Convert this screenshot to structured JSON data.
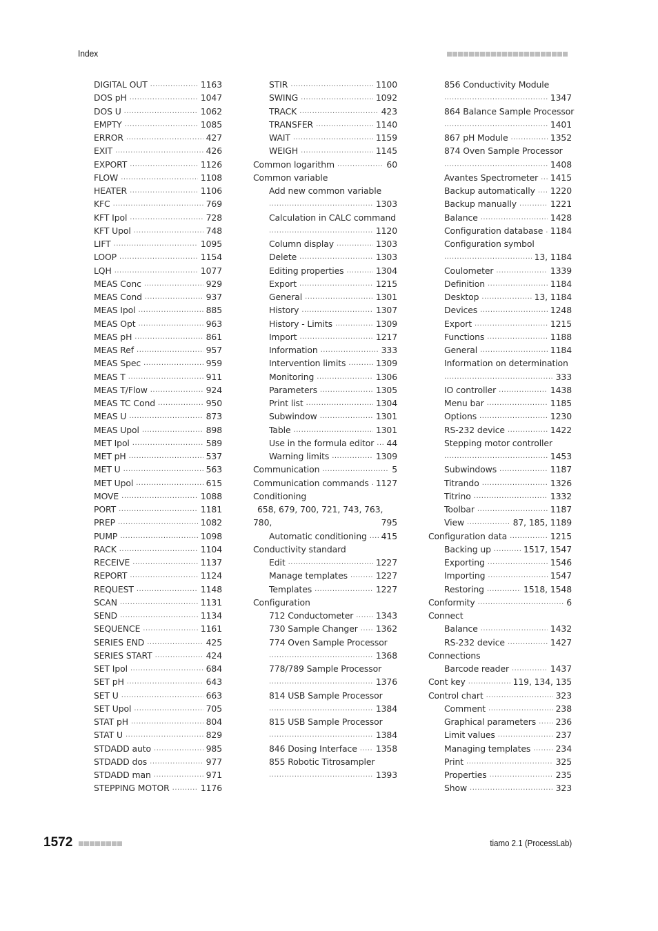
{
  "header": {
    "title": "Index"
  },
  "footer": {
    "page_number": "1572",
    "product": "tiamo 2.1 (ProcessLab)"
  },
  "columns": [
    [
      {
        "level": 1,
        "text": "DIGITAL OUT",
        "pages": "1163"
      },
      {
        "level": 1,
        "text": "DOS pH",
        "pages": "1047"
      },
      {
        "level": 1,
        "text": "DOS U",
        "pages": "1062"
      },
      {
        "level": 1,
        "text": "EMPTY",
        "pages": "1085"
      },
      {
        "level": 1,
        "text": "ERROR",
        "pages": "427"
      },
      {
        "level": 1,
        "text": "EXIT",
        "pages": "426"
      },
      {
        "level": 1,
        "text": "EXPORT",
        "pages": "1126"
      },
      {
        "level": 1,
        "text": "FLOW",
        "pages": "1108"
      },
      {
        "level": 1,
        "text": "HEATER",
        "pages": "1106"
      },
      {
        "level": 1,
        "text": "KFC",
        "pages": "769"
      },
      {
        "level": 1,
        "text": "KFT Ipol",
        "pages": "728"
      },
      {
        "level": 1,
        "text": "KFT Upol",
        "pages": "748"
      },
      {
        "level": 1,
        "text": "LIFT",
        "pages": "1095"
      },
      {
        "level": 1,
        "text": "LOOP",
        "pages": "1154"
      },
      {
        "level": 1,
        "text": "LQH",
        "pages": "1077"
      },
      {
        "level": 1,
        "text": "MEAS Conc",
        "pages": "929"
      },
      {
        "level": 1,
        "text": "MEAS Cond",
        "pages": "937"
      },
      {
        "level": 1,
        "text": "MEAS Ipol",
        "pages": "885"
      },
      {
        "level": 1,
        "text": "MEAS Opt",
        "pages": "963"
      },
      {
        "level": 1,
        "text": "MEAS pH",
        "pages": "861"
      },
      {
        "level": 1,
        "text": "MEAS Ref",
        "pages": "957"
      },
      {
        "level": 1,
        "text": "MEAS Spec",
        "pages": "959"
      },
      {
        "level": 1,
        "text": "MEAS T",
        "pages": "911"
      },
      {
        "level": 1,
        "text": "MEAS T/Flow",
        "pages": "924"
      },
      {
        "level": 1,
        "text": "MEAS TC Cond",
        "pages": "950"
      },
      {
        "level": 1,
        "text": "MEAS U",
        "pages": "873"
      },
      {
        "level": 1,
        "text": "MEAS Upol",
        "pages": "898"
      },
      {
        "level": 1,
        "text": "MET Ipol",
        "pages": "589"
      },
      {
        "level": 1,
        "text": "MET pH",
        "pages": "537"
      },
      {
        "level": 1,
        "text": "MET U",
        "pages": "563"
      },
      {
        "level": 1,
        "text": "MET Upol",
        "pages": "615"
      },
      {
        "level": 1,
        "text": "MOVE",
        "pages": "1088"
      },
      {
        "level": 1,
        "text": "PORT",
        "pages": "1181"
      },
      {
        "level": 1,
        "text": "PREP",
        "pages": "1082"
      },
      {
        "level": 1,
        "text": "PUMP",
        "pages": "1098"
      },
      {
        "level": 1,
        "text": "RACK",
        "pages": "1104"
      },
      {
        "level": 1,
        "text": "RECEIVE",
        "pages": "1137"
      },
      {
        "level": 1,
        "text": "REPORT",
        "pages": "1124"
      },
      {
        "level": 1,
        "text": "REQUEST",
        "pages": "1148"
      },
      {
        "level": 1,
        "text": "SCAN",
        "pages": "1131"
      },
      {
        "level": 1,
        "text": "SEND",
        "pages": "1134"
      },
      {
        "level": 1,
        "text": "SEQUENCE",
        "pages": "1161"
      },
      {
        "level": 1,
        "text": "SERIES END",
        "pages": "425"
      },
      {
        "level": 1,
        "text": "SERIES START",
        "pages": "424"
      },
      {
        "level": 1,
        "text": "SET Ipol",
        "pages": "684"
      },
      {
        "level": 1,
        "text": "SET pH",
        "pages": "643"
      },
      {
        "level": 1,
        "text": "SET U",
        "pages": "663"
      },
      {
        "level": 1,
        "text": "SET Upol",
        "pages": "705"
      },
      {
        "level": 1,
        "text": "STAT pH",
        "pages": "804"
      },
      {
        "level": 1,
        "text": "STAT U",
        "pages": "829"
      },
      {
        "level": 1,
        "text": "STDADD auto",
        "pages": "985"
      },
      {
        "level": 1,
        "text": "STDADD dos",
        "pages": "977"
      },
      {
        "level": 1,
        "text": "STDADD man",
        "pages": "971"
      },
      {
        "level": 1,
        "text": "STEPPING MOTOR",
        "pages": "1176"
      }
    ],
    [
      {
        "level": 1,
        "text": "STIR",
        "pages": "1100"
      },
      {
        "level": 1,
        "text": "SWING",
        "pages": "1092"
      },
      {
        "level": 1,
        "text": "TRACK",
        "pages": "423"
      },
      {
        "level": 1,
        "text": "TRANSFER",
        "pages": "1140"
      },
      {
        "level": 1,
        "text": "WAIT",
        "pages": "1159"
      },
      {
        "level": 1,
        "text": "WEIGH",
        "pages": "1145"
      },
      {
        "level": 0,
        "text": "Common logarithm",
        "pages": "60"
      },
      {
        "level": 0,
        "text": "Common variable",
        "pages": ""
      },
      {
        "level": 1,
        "text": "Add new common variable",
        "pages": ""
      },
      {
        "level": 2,
        "text": "",
        "pages": "1303"
      },
      {
        "level": 1,
        "text": "Calculation in CALC command",
        "pages": ""
      },
      {
        "level": 2,
        "text": "",
        "pages": "1120"
      },
      {
        "level": 1,
        "text": "Column display",
        "pages": "1303"
      },
      {
        "level": 1,
        "text": "Delete",
        "pages": "1303"
      },
      {
        "level": 1,
        "text": "Editing properties",
        "pages": "1304"
      },
      {
        "level": 1,
        "text": "Export",
        "pages": "1215"
      },
      {
        "level": 1,
        "text": "General",
        "pages": "1301"
      },
      {
        "level": 1,
        "text": "History",
        "pages": "1307"
      },
      {
        "level": 1,
        "text": "History - Limits",
        "pages": "1309"
      },
      {
        "level": 1,
        "text": "Import",
        "pages": "1217"
      },
      {
        "level": 1,
        "text": "Information",
        "pages": "333"
      },
      {
        "level": 1,
        "text": "Intervention limits",
        "pages": "1309"
      },
      {
        "level": 1,
        "text": "Monitoring",
        "pages": "1306"
      },
      {
        "level": 1,
        "text": "Parameters",
        "pages": "1305"
      },
      {
        "level": 1,
        "text": "Print list",
        "pages": "1304"
      },
      {
        "level": 1,
        "text": "Subwindow",
        "pages": "1301"
      },
      {
        "level": 1,
        "text": "Table",
        "pages": "1301"
      },
      {
        "level": 1,
        "text": "Use in the formula editor",
        "pages": "44"
      },
      {
        "level": 1,
        "text": "Warning limits",
        "pages": "1309"
      },
      {
        "level": 0,
        "text": "Communication",
        "pages": "5"
      },
      {
        "level": 0,
        "text": "Communication commands",
        "pages": "1127"
      },
      {
        "level": 0,
        "text": "Conditioning",
        "pages": ""
      },
      {
        "level": 3,
        "text": "658, 679, 700, 721, 743, 763,",
        "pages": ""
      },
      {
        "level": 4,
        "text": "780,",
        "pages": "795"
      },
      {
        "level": 1,
        "text": "Automatic conditioning",
        "pages": "415"
      },
      {
        "level": 0,
        "text": "Conductivity standard",
        "pages": ""
      },
      {
        "level": 1,
        "text": "Edit",
        "pages": "1227"
      },
      {
        "level": 1,
        "text": "Manage templates",
        "pages": "1227"
      },
      {
        "level": 1,
        "text": "Templates",
        "pages": "1227"
      },
      {
        "level": 0,
        "text": "Configuration",
        "pages": ""
      },
      {
        "level": 1,
        "text": "712 Conductometer",
        "pages": "1343"
      },
      {
        "level": 1,
        "text": "730 Sample Changer",
        "pages": "1362"
      },
      {
        "level": 1,
        "text": "774 Oven Sample Processor",
        "pages": ""
      },
      {
        "level": 2,
        "text": "",
        "pages": "1368"
      },
      {
        "level": 1,
        "text": "778/789 Sample Processor",
        "pages": ""
      },
      {
        "level": 2,
        "text": "",
        "pages": "1376"
      },
      {
        "level": 1,
        "text": "814 USB Sample Processor",
        "pages": ""
      },
      {
        "level": 2,
        "text": "",
        "pages": "1384"
      },
      {
        "level": 1,
        "text": "815 USB Sample Processor",
        "pages": ""
      },
      {
        "level": 2,
        "text": "",
        "pages": "1384"
      },
      {
        "level": 1,
        "text": "846 Dosing Interface",
        "pages": "1358"
      },
      {
        "level": 1,
        "text": "855 Robotic Titrosampler",
        "pages": ""
      },
      {
        "level": 2,
        "text": "",
        "pages": "1393"
      }
    ],
    [
      {
        "level": 1,
        "text": "856 Conductivity Module",
        "pages": ""
      },
      {
        "level": 2,
        "text": "",
        "pages": "1347"
      },
      {
        "level": 1,
        "text": "864 Balance Sample Processor",
        "pages": ""
      },
      {
        "level": 2,
        "text": "",
        "pages": "1401"
      },
      {
        "level": 1,
        "text": "867 pH Module",
        "pages": "1352"
      },
      {
        "level": 1,
        "text": "874 Oven Sample Processor",
        "pages": ""
      },
      {
        "level": 2,
        "text": "",
        "pages": "1408"
      },
      {
        "level": 1,
        "text": "Avantes Spectrometer",
        "pages": "1415"
      },
      {
        "level": 1,
        "text": "Backup automatically",
        "pages": "1220"
      },
      {
        "level": 1,
        "text": "Backup manually",
        "pages": "1221"
      },
      {
        "level": 1,
        "text": "Balance",
        "pages": "1428"
      },
      {
        "level": 1,
        "text": "Configuration database",
        "pages": "1184"
      },
      {
        "level": 1,
        "text": "Configuration symbol",
        "pages": ""
      },
      {
        "level": 2,
        "text": "",
        "pages": "13, 1184"
      },
      {
        "level": 1,
        "text": "Coulometer",
        "pages": "1339"
      },
      {
        "level": 1,
        "text": "Definition",
        "pages": "1184"
      },
      {
        "level": 1,
        "text": "Desktop",
        "pages": "13, 1184"
      },
      {
        "level": 1,
        "text": "Devices",
        "pages": "1248"
      },
      {
        "level": 1,
        "text": "Export",
        "pages": "1215"
      },
      {
        "level": 1,
        "text": "Functions",
        "pages": "1188"
      },
      {
        "level": 1,
        "text": "General",
        "pages": "1184"
      },
      {
        "level": 1,
        "text": "Information on determination",
        "pages": ""
      },
      {
        "level": 2,
        "text": "",
        "pages": "333"
      },
      {
        "level": 1,
        "text": "IO controller",
        "pages": "1438"
      },
      {
        "level": 1,
        "text": "Menu bar",
        "pages": "1185"
      },
      {
        "level": 1,
        "text": "Options",
        "pages": "1230"
      },
      {
        "level": 1,
        "text": "RS-232 device",
        "pages": "1422"
      },
      {
        "level": 1,
        "text": "Stepping motor controller",
        "pages": ""
      },
      {
        "level": 2,
        "text": "",
        "pages": "1453"
      },
      {
        "level": 1,
        "text": "Subwindows",
        "pages": "1187"
      },
      {
        "level": 1,
        "text": "Titrando",
        "pages": "1326"
      },
      {
        "level": 1,
        "text": "Titrino",
        "pages": "1332"
      },
      {
        "level": 1,
        "text": "Toolbar",
        "pages": "1187"
      },
      {
        "level": 1,
        "text": "View",
        "pages": "87, 185, 1189"
      },
      {
        "level": 0,
        "text": "Configuration data",
        "pages": "1215"
      },
      {
        "level": 1,
        "text": "Backing up",
        "pages": "1517, 1547"
      },
      {
        "level": 1,
        "text": "Exporting",
        "pages": "1546"
      },
      {
        "level": 1,
        "text": "Importing",
        "pages": "1547"
      },
      {
        "level": 1,
        "text": "Restoring",
        "pages": "1518, 1548"
      },
      {
        "level": 0,
        "text": "Conformity",
        "pages": "6"
      },
      {
        "level": 0,
        "text": "Connect",
        "pages": ""
      },
      {
        "level": 1,
        "text": "Balance",
        "pages": "1432"
      },
      {
        "level": 1,
        "text": "RS-232 device",
        "pages": "1427"
      },
      {
        "level": 0,
        "text": "Connections",
        "pages": ""
      },
      {
        "level": 1,
        "text": "Barcode reader",
        "pages": "1437"
      },
      {
        "level": 0,
        "text": "Cont key",
        "pages": "119, 134, 135"
      },
      {
        "level": 0,
        "text": "Control chart",
        "pages": "323"
      },
      {
        "level": 1,
        "text": "Comment",
        "pages": "238"
      },
      {
        "level": 1,
        "text": "Graphical parameters",
        "pages": "236"
      },
      {
        "level": 1,
        "text": "Limit values",
        "pages": "237"
      },
      {
        "level": 1,
        "text": "Managing templates",
        "pages": "234"
      },
      {
        "level": 1,
        "text": "Print",
        "pages": "325"
      },
      {
        "level": 1,
        "text": "Properties",
        "pages": "235"
      },
      {
        "level": 1,
        "text": "Show",
        "pages": "323"
      }
    ]
  ]
}
